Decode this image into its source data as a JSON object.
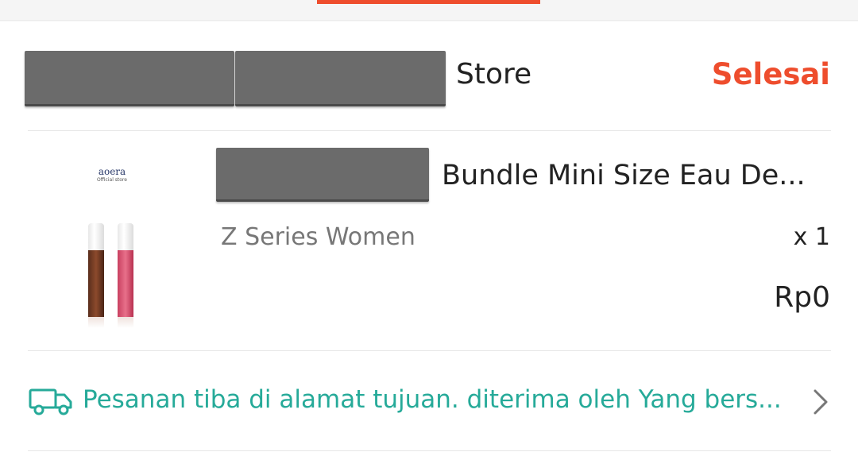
{
  "shop": {
    "name": "Store",
    "status": "Selesai"
  },
  "product": {
    "title": "Bundle Mini Size Eau De...",
    "variation": "Z Series Women",
    "quantity": "x 1",
    "price": "Rp0",
    "thumbnail": {
      "brand": "aoera",
      "subtitle": "Official store"
    }
  },
  "shipping": {
    "status_text": "Pesanan tiba di alamat tujuan. diterima oleh Yang bers...",
    "icon": "truck-icon",
    "action_icon": "chevron-right-icon"
  },
  "colors": {
    "accent": "#ee4d2d",
    "shipping": "#26aa99",
    "redaction": "#6b6b6b"
  }
}
